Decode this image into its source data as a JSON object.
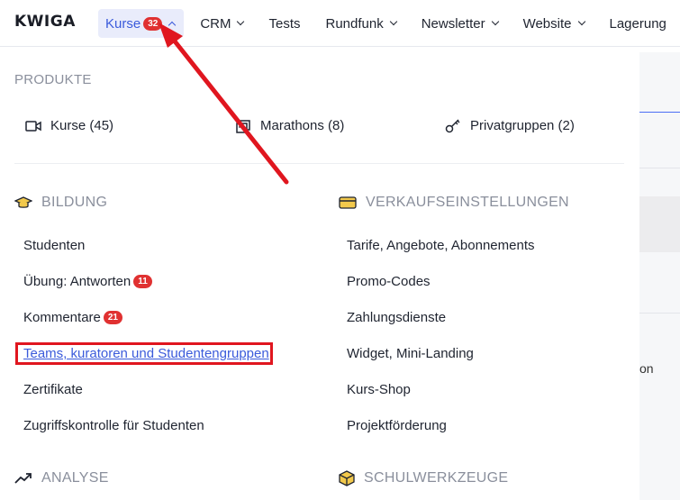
{
  "nav": {
    "logo": "KWIGA",
    "items": [
      {
        "label": "Kurse",
        "badge": "32"
      },
      {
        "label": "CRM"
      },
      {
        "label": "Tests"
      },
      {
        "label": "Rundfunk"
      },
      {
        "label": "Newsletter"
      },
      {
        "label": "Website"
      },
      {
        "label": "Lagerung"
      }
    ]
  },
  "products": {
    "heading": "PRODUKTE",
    "items": [
      {
        "label": "Kurse (45)",
        "icon": "video-icon"
      },
      {
        "label": "Marathons (8)",
        "icon": "stack-icon"
      },
      {
        "label": "Privatgruppen (2)",
        "icon": "key-icon"
      }
    ]
  },
  "bildung": {
    "heading": "BILDUNG",
    "items": [
      {
        "label": "Studenten"
      },
      {
        "label": "Übung: Antworten",
        "badge": "11"
      },
      {
        "label": "Kommentare",
        "badge": "21"
      },
      {
        "label": "Teams, kuratoren und Studentengruppen"
      },
      {
        "label": "Zertifikate"
      },
      {
        "label": "Zugriffskontrolle für Studenten"
      }
    ]
  },
  "verkauf": {
    "heading": "VERKAUFSEINSTELLUNGEN",
    "items": [
      {
        "label": "Tarife, Angebote, Abonnements"
      },
      {
        "label": "Promo-Codes"
      },
      {
        "label": "Zahlungsdienste"
      },
      {
        "label": "Widget, Mini-Landing"
      },
      {
        "label": "Kurs-Shop"
      },
      {
        "label": "Projektförderung"
      }
    ]
  },
  "bottom": {
    "analyse": "ANALYSE",
    "schulwerkzeuge": "SCHULWERKZEUGE"
  },
  "background": {
    "partial_text": "on"
  },
  "colors": {
    "accent": "#3b5bdb",
    "badge": "#e03131",
    "annotation": "#e0161f"
  }
}
